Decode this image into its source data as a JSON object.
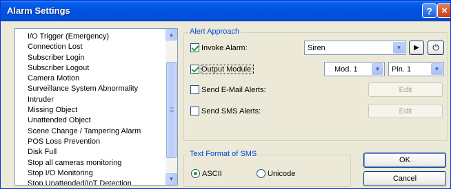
{
  "window": {
    "title": "Alarm Settings",
    "help_glyph": "?",
    "close_glyph": "×"
  },
  "event_list": {
    "items": [
      "I/O Trigger (Emergency)",
      "Connection Lost",
      "Subscriber Login",
      "Subscriber Logout",
      "Camera Motion",
      "Surveillance System Abnormality",
      "Intruder",
      "Missing Object",
      "Unattended Object",
      "Scene Change / Tampering Alarm",
      "POS Loss Prevention",
      "Disk Full",
      "Stop all cameras monitoring",
      "Stop I/O Monitoring",
      "Stop Unattended/IoT Detection"
    ]
  },
  "alert_approach": {
    "legend": "Alert Approach",
    "invoke_alarm": {
      "label": "Invoke Alarm:",
      "checked": true,
      "value": "Siren",
      "play_glyph": "▶",
      "reset_glyph": "⏻"
    },
    "output_module": {
      "label": "Output Module:",
      "checked": true,
      "module_value": "Mod. 1",
      "pin_value": "Pin. 1"
    },
    "email_alerts": {
      "label": "Send E-Mail Alerts:",
      "checked": false,
      "edit_label": "Edit"
    },
    "sms_alerts": {
      "label": "Send SMS Alerts:",
      "checked": false,
      "edit_label": "Edit"
    }
  },
  "sms_format": {
    "legend": "Text Format of SMS",
    "options": [
      "ASCII",
      "Unicode"
    ],
    "selected": "ASCII"
  },
  "buttons": {
    "ok": "OK",
    "cancel": "Cancel"
  }
}
